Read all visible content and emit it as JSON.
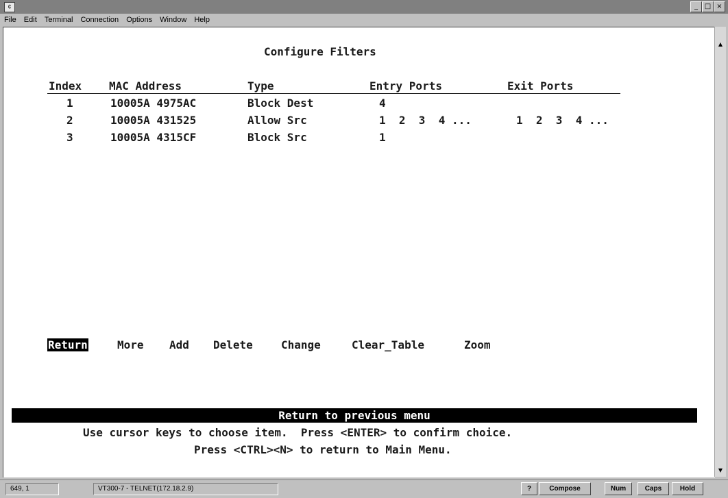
{
  "window": {
    "icon_glyph": "¢",
    "controls": {
      "minimize": "_",
      "maximize": "□",
      "close": "×"
    }
  },
  "menu": [
    "File",
    "Edit",
    "Terminal",
    "Connection",
    "Options",
    "Window",
    "Help"
  ],
  "screen": {
    "title": "Configure Filters",
    "columns": {
      "index": "Index",
      "mac": "MAC Address",
      "type": "Type",
      "entry": "Entry Ports",
      "exit": "Exit Ports"
    },
    "rows": [
      {
        "index": "1",
        "mac": "10005A 4975AC",
        "type": "Block Dest",
        "entry": "4",
        "exit": ""
      },
      {
        "index": "2",
        "mac": "10005A 431525",
        "type": "Allow Src",
        "entry": "1  2  3  4 ...",
        "exit": "1  2  3  4 ..."
      },
      {
        "index": "3",
        "mac": "10005A 4315CF",
        "type": "Block Src",
        "entry": "1",
        "exit": ""
      }
    ],
    "actions": [
      "Return",
      "More",
      "Add",
      "Delete",
      "Change",
      "Clear_Table",
      "Zoom"
    ],
    "selected_action": "Return",
    "help_bar": "Return to previous menu",
    "hint1": "Use cursor keys to choose item.  Press <ENTER> to confirm choice.",
    "hint2": "Press <CTRL><N> to return to Main Menu."
  },
  "status": {
    "position": "649, 1",
    "emulation": "VT300-7 - TELNET(172.18.2.9)",
    "buttons": [
      "?",
      "Compose",
      "Num",
      "Caps",
      "Hold"
    ]
  },
  "icons": {
    "app": "terminal-app-icon",
    "scroll_up": "up-arrow-icon",
    "scroll_down": "down-arrow-icon"
  }
}
